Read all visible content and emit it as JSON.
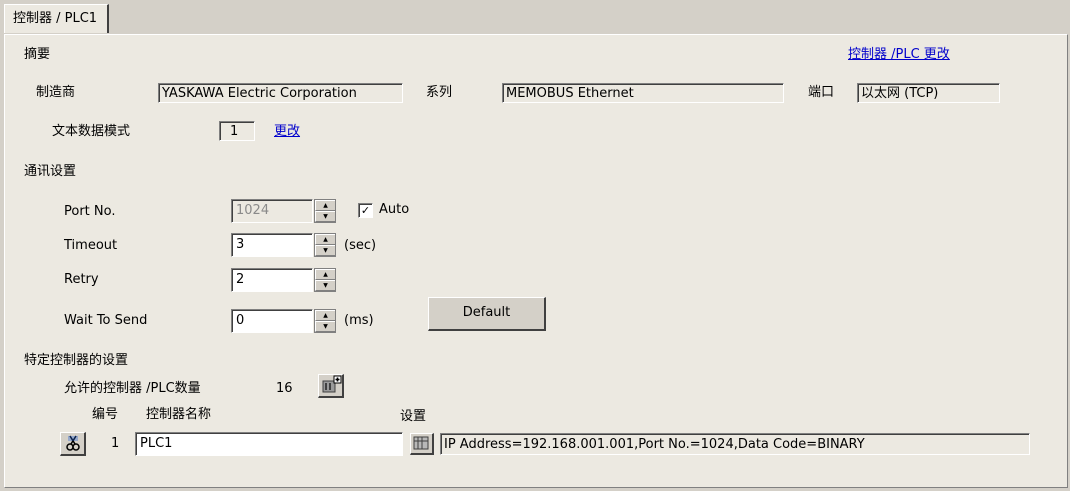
{
  "tab": {
    "label": "控制器 / PLC1"
  },
  "summary": {
    "heading": "摘要",
    "change_link": "控制器 /PLC 更改",
    "maker_label": "制造商",
    "maker_value": "YASKAWA Electric Corporation",
    "series_label": "系列",
    "series_value": "MEMOBUS Ethernet",
    "port_label": "端口",
    "port_value": "以太网 (TCP)",
    "text_mode_label": "文本数据模式",
    "text_mode_value": "1",
    "text_mode_change": "更改"
  },
  "comm": {
    "heading": "通讯设置",
    "port_no_label": "Port No.",
    "port_no_value": "1024",
    "auto_label": "Auto",
    "auto_checked": true,
    "timeout_label": "Timeout",
    "timeout_value": "3",
    "timeout_unit": "(sec)",
    "retry_label": "Retry",
    "retry_value": "2",
    "wait_label": "Wait To Send",
    "wait_value": "0",
    "wait_unit": "(ms)",
    "default_button": "Default"
  },
  "device": {
    "heading": "特定控制器的设置",
    "allowed_label": "允许的控制器 /PLC数量",
    "allowed_count": "16",
    "col_number": "编号",
    "col_name": "控制器名称",
    "col_settings": "设置",
    "rows": [
      {
        "number": "1",
        "name": "PLC1",
        "settings": "IP Address=192.168.001.001,Port No.=1024,Data Code=BINARY"
      }
    ]
  },
  "icons": {
    "spin": "spin-arrows-icon",
    "add_device": "add-device-icon",
    "cut": "scissors-icon",
    "settings": "settings-grid-icon"
  }
}
